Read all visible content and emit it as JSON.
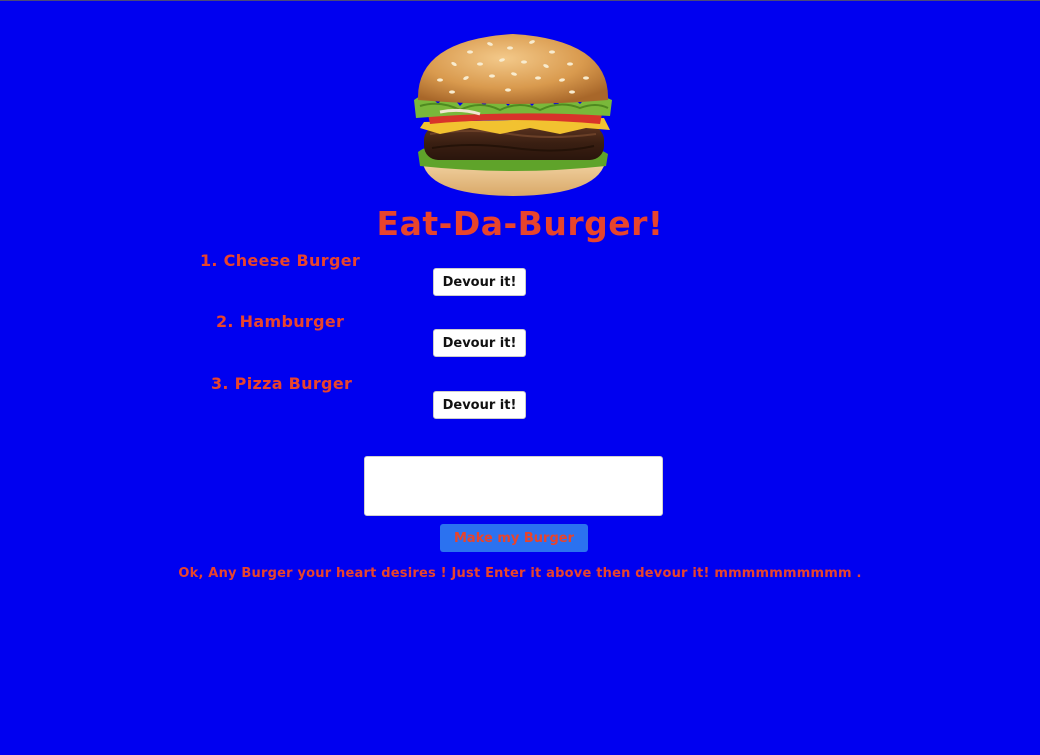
{
  "page": {
    "title": "Eat-Da-Burger!",
    "hero_image": "burger-image",
    "colors": {
      "background": "#0000f0",
      "accent_text": "#e8442c",
      "make_button_bg": "#2b72f0"
    }
  },
  "burgers": [
    {
      "label": "1. Cheese Burger",
      "button": "Devour it!"
    },
    {
      "label": "2. Hamburger",
      "button": "Devour it!"
    },
    {
      "label": "3. Pizza Burger",
      "button": "Devour it!"
    }
  ],
  "form": {
    "input_value": "",
    "submit_label": "Make my Burger"
  },
  "tagline": "Ok, Any Burger your heart desires ! Just Enter it above then devour it! mmmmmmmmmm ."
}
